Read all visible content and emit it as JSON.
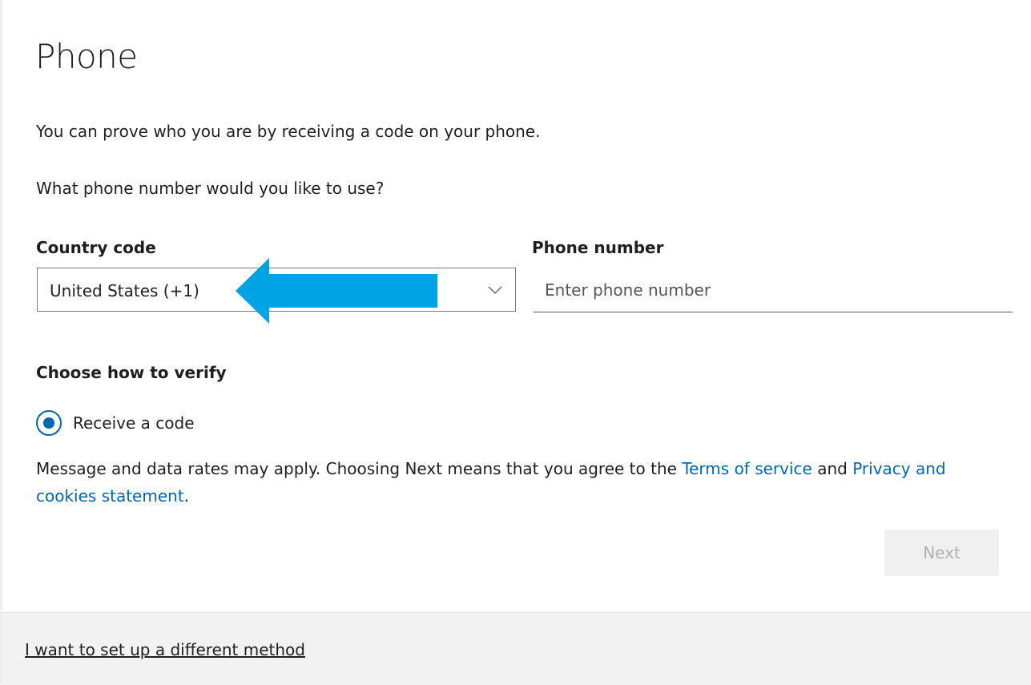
{
  "page": {
    "title": "Phone",
    "intro": "You can prove who you are by receiving a code on your phone.",
    "question": "What phone number would you like to use?"
  },
  "country": {
    "label": "Country code",
    "selected": "United States (+1)",
    "chevron_icon": "chevron-down-icon"
  },
  "phone": {
    "label": "Phone number",
    "placeholder": "Enter phone number",
    "value": ""
  },
  "verify": {
    "label": "Choose how to verify",
    "options": [
      {
        "label": "Receive a code",
        "selected": true
      }
    ]
  },
  "terms": {
    "text_before": "Message and data rates may apply. Choosing Next means that you agree to the ",
    "terms_link": "Terms of service",
    "and": " and ",
    "privacy_link": "Privacy and cookies statement",
    "text_after": "."
  },
  "actions": {
    "next_label": "Next",
    "next_enabled": false
  },
  "footer": {
    "alt_method_link": "I want to set up a different method"
  },
  "annotation": {
    "arrow_color": "#00a4e4",
    "arrow_icon": "left-arrow-icon"
  },
  "colors": {
    "accent": "#0067b8",
    "footer_bg": "#f2f2f2",
    "button_disabled_bg": "#f0f0f0"
  }
}
